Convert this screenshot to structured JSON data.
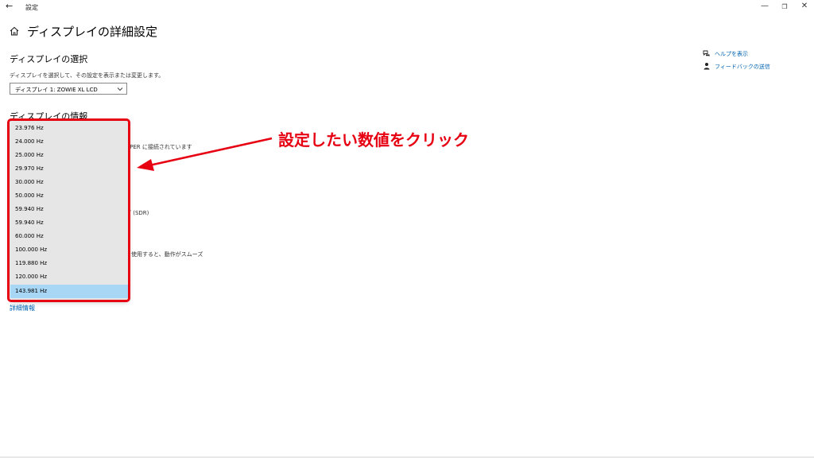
{
  "window": {
    "back_glyph": "←",
    "title": "設定",
    "minimize_glyph": "—",
    "maximize_glyph": "❐",
    "close_glyph": "✕"
  },
  "header": {
    "title": "ディスプレイの詳細設定",
    "home_icon": "home-icon"
  },
  "display_select": {
    "heading": "ディスプレイの選択",
    "description": "ディスプレイを選択して、その設定を表示または変更します。",
    "selected": "ディスプレイ 1: ZOWIE XL LCD"
  },
  "display_info": {
    "heading": "ディスプレイの情報",
    "partial_line_1": "UPER に接続されています",
    "partial_line_2": "ブ (SDR)",
    "partial_line_3": "を使用すると、動作がスムーズ",
    "details_link": "詳細情報"
  },
  "refresh_rates": {
    "options": [
      "23.976 Hz",
      "24.000 Hz",
      "25.000 Hz",
      "29.970 Hz",
      "30.000 Hz",
      "50.000 Hz",
      "59.940 Hz",
      "59.940 Hz",
      "60.000 Hz",
      "100.000 Hz",
      "119.880 Hz",
      "120.000 Hz",
      "143.981 Hz"
    ],
    "selected_index": 12
  },
  "annotation": {
    "text": "設定したい数値をクリック",
    "color": "#e60012"
  },
  "help": {
    "help_link": "ヘルプを表示",
    "feedback_link": "フィードバックの送信",
    "link_color": "#0063b1"
  }
}
